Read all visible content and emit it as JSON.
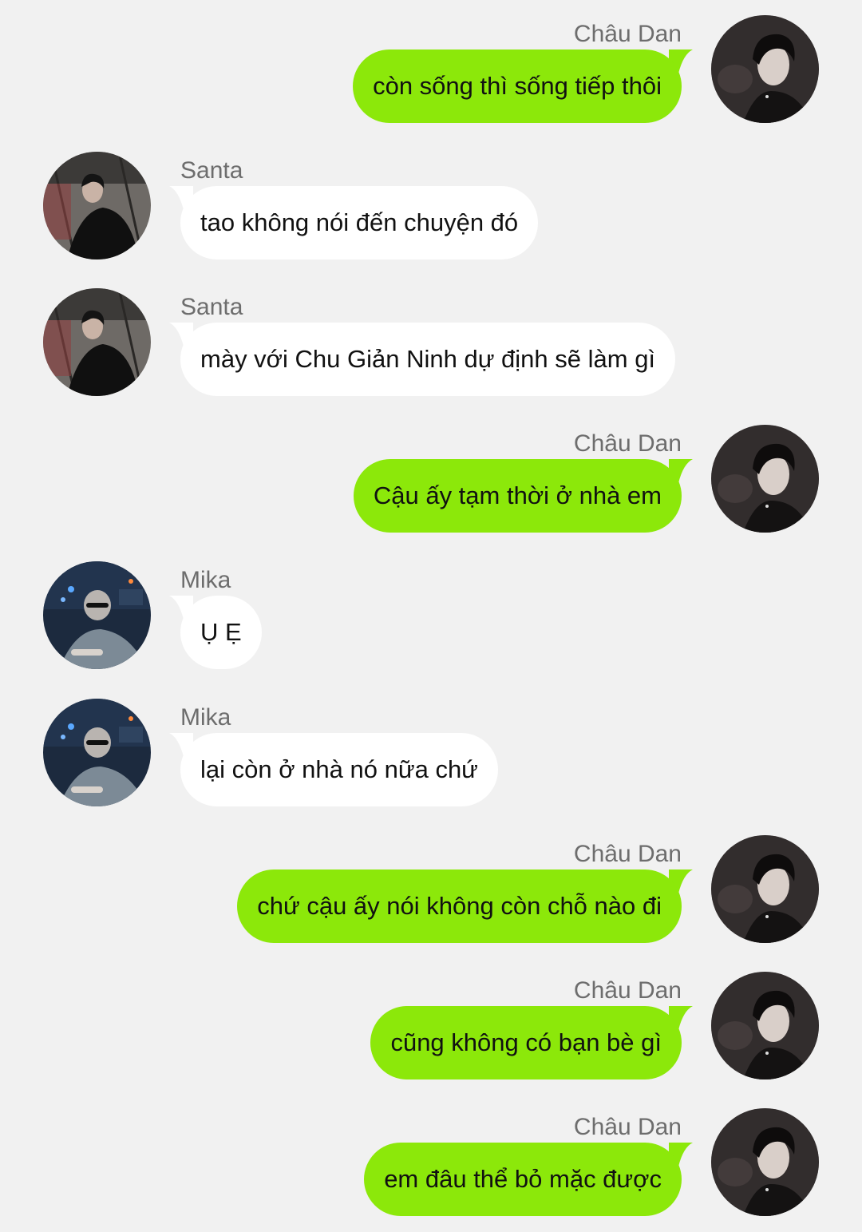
{
  "colors": {
    "background": "#f1f1f1",
    "outgoing_bubble": "#8ce80a",
    "incoming_bubble": "#ffffff",
    "name_text": "#6d6d6d",
    "message_text": "#111111"
  },
  "messages": [
    {
      "sender": "Châu Dan",
      "side": "right",
      "avatar": "chau-dan-avatar",
      "text": "còn sống thì sống tiếp thôi"
    },
    {
      "sender": "Santa",
      "side": "left",
      "avatar": "santa-avatar",
      "text": "tao không nói đến chuyện đó"
    },
    {
      "sender": "Santa",
      "side": "left",
      "avatar": "santa-avatar",
      "text": "mày với Chu Giản Ninh dự định sẽ làm gì"
    },
    {
      "sender": "Châu Dan",
      "side": "right",
      "avatar": "chau-dan-avatar",
      "text": "Cậu ấy tạm thời ở nhà em"
    },
    {
      "sender": "Mika",
      "side": "left",
      "avatar": "mika-avatar",
      "text": "Ụ Ẹ"
    },
    {
      "sender": "Mika",
      "side": "left",
      "avatar": "mika-avatar",
      "text": "lại còn ở nhà nó nữa chứ"
    },
    {
      "sender": "Châu Dan",
      "side": "right",
      "avatar": "chau-dan-avatar",
      "text": "chứ cậu ấy nói không còn chỗ nào đi"
    },
    {
      "sender": "Châu Dan",
      "side": "right",
      "avatar": "chau-dan-avatar",
      "text": "cũng không có bạn bè gì"
    },
    {
      "sender": "Châu Dan",
      "side": "right",
      "avatar": "chau-dan-avatar",
      "text": "em đâu thể bỏ mặc được"
    }
  ]
}
